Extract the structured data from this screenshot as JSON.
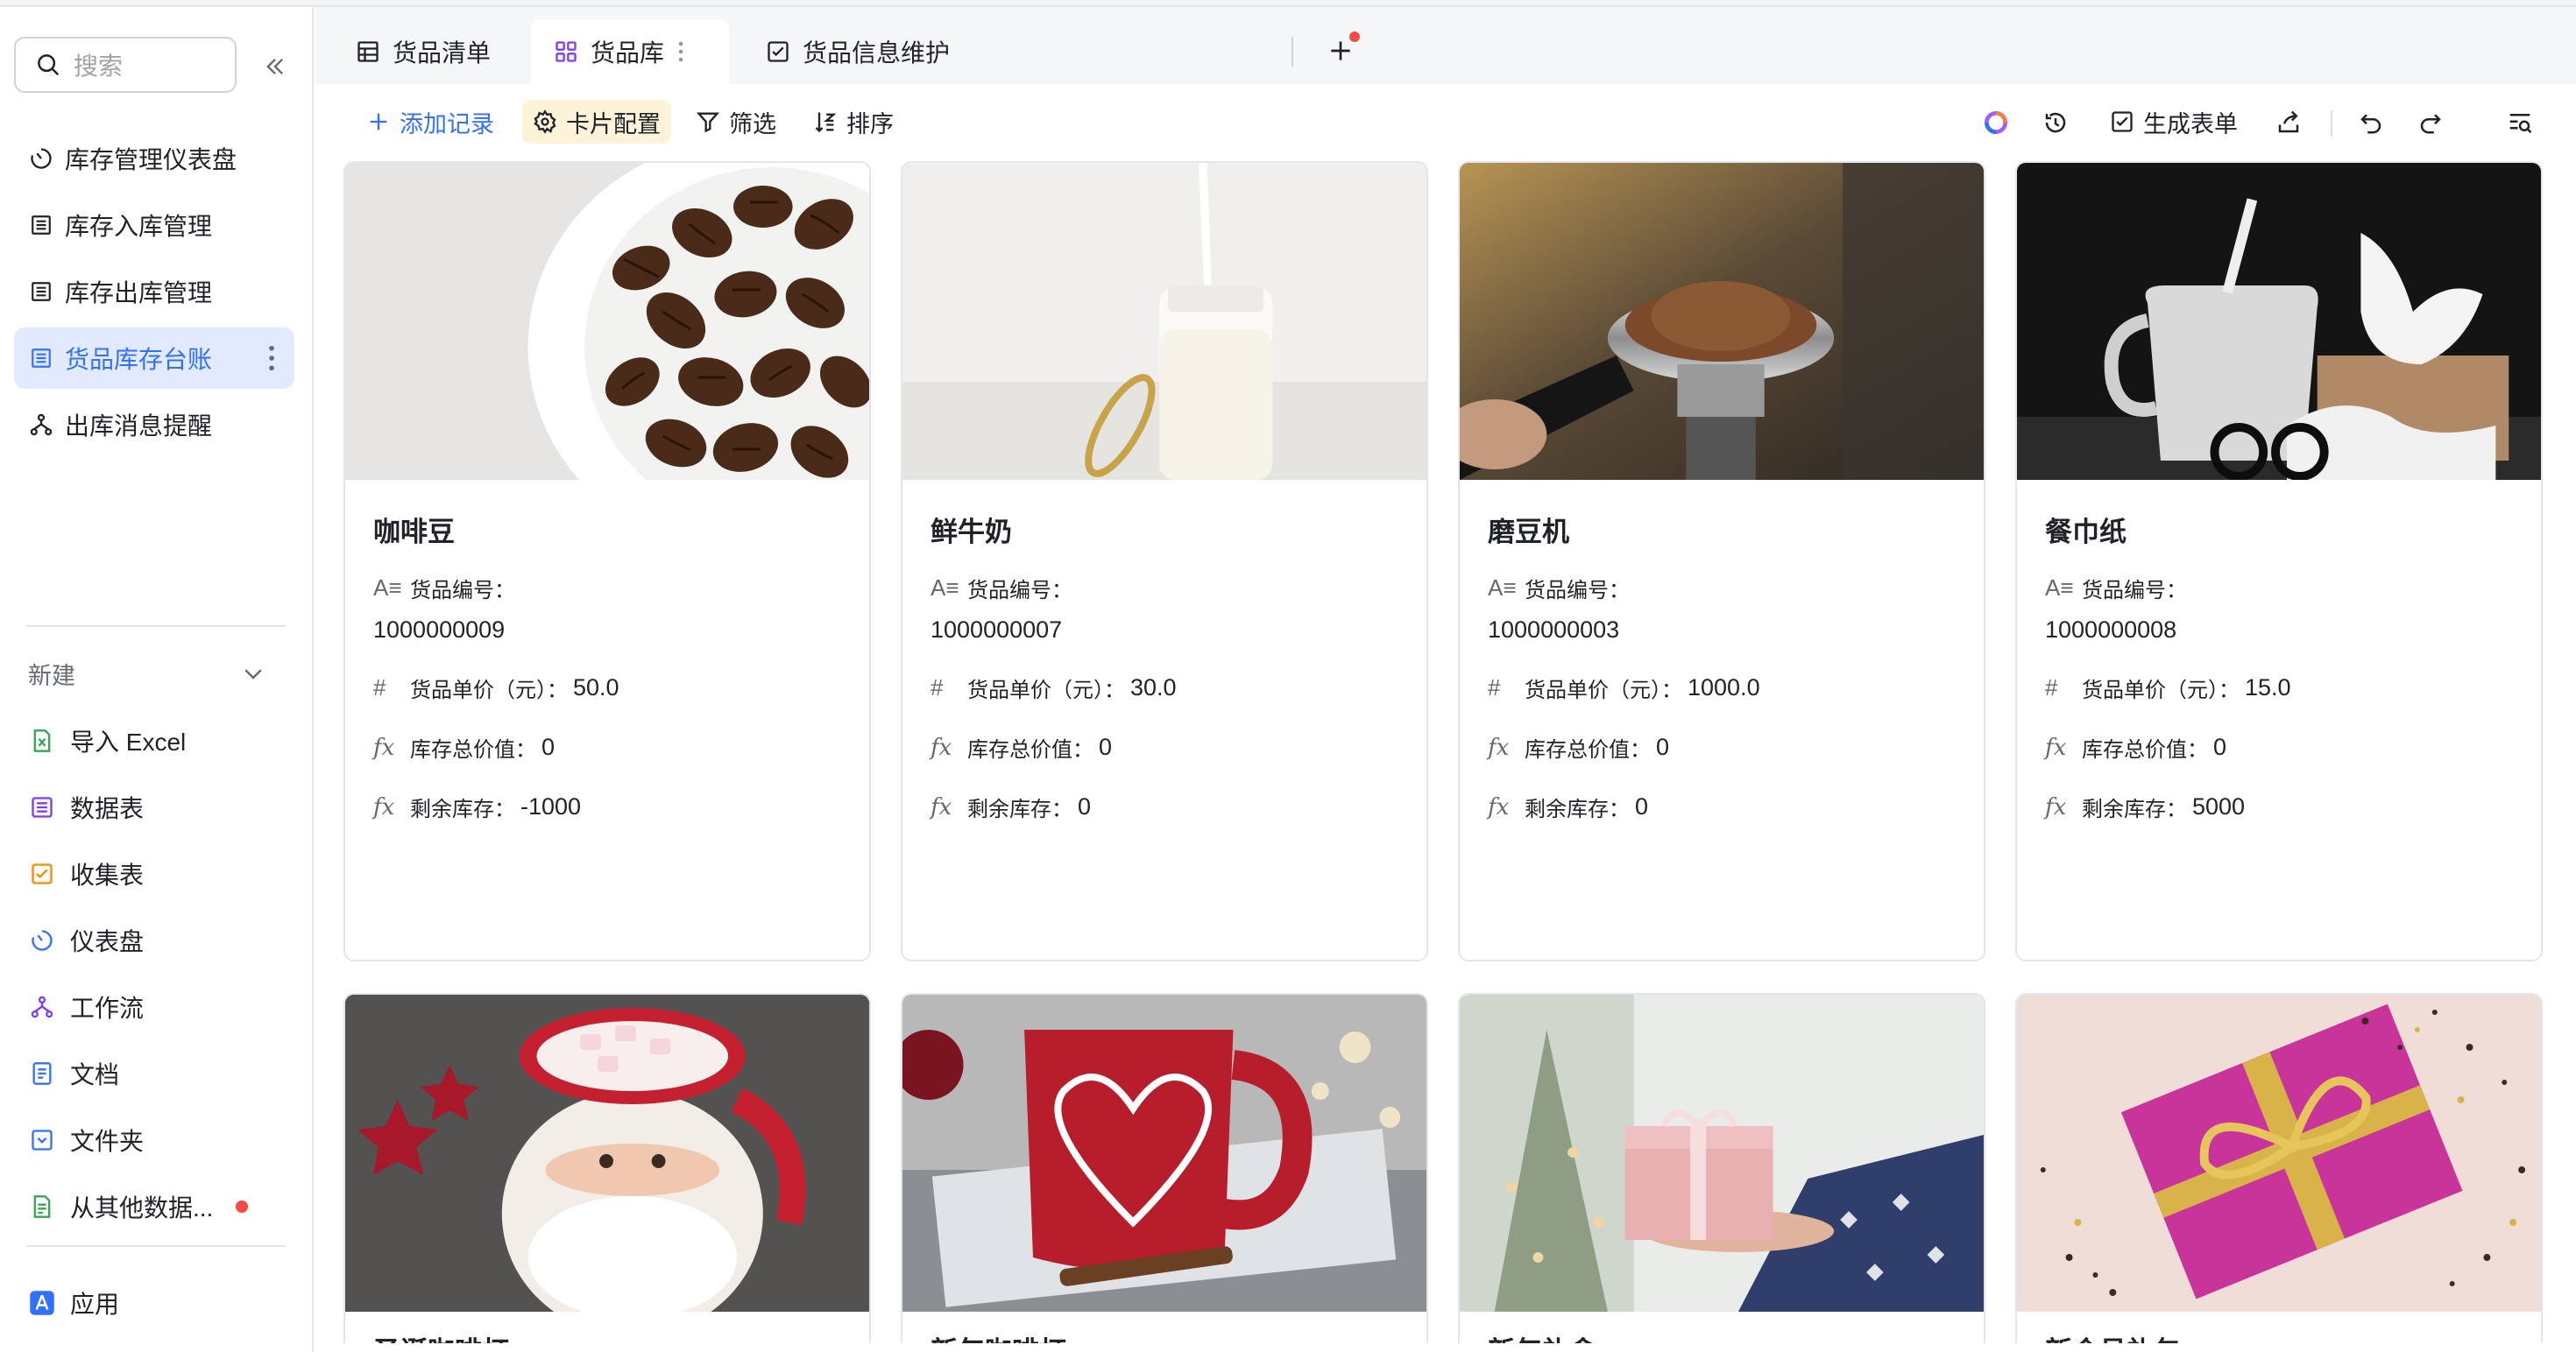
{
  "sidebar": {
    "search_placeholder": "搜索",
    "nav": [
      {
        "label": "库存管理仪表盘",
        "icon": "dashboard-icon"
      },
      {
        "label": "库存入库管理",
        "icon": "table-icon"
      },
      {
        "label": "库存出库管理",
        "icon": "table-icon"
      },
      {
        "label": "货品库存台账",
        "icon": "table-icon",
        "active": true
      },
      {
        "label": "出库消息提醒",
        "icon": "workflow-icon"
      }
    ],
    "new_label": "新建",
    "new_items": [
      {
        "label": "导入 Excel",
        "icon": "excel-icon",
        "color": "#34a853"
      },
      {
        "label": "数据表",
        "icon": "datatable-icon",
        "color": "#7f3bf5"
      },
      {
        "label": "收集表",
        "icon": "form-icon",
        "color": "#ff8800"
      },
      {
        "label": "仪表盘",
        "icon": "dashboard-icon",
        "color": "#3370ff"
      },
      {
        "label": "工作流",
        "icon": "workflow-icon",
        "color": "#7f3bf5"
      },
      {
        "label": "文档",
        "icon": "doc-icon",
        "color": "#3370ff"
      },
      {
        "label": "文件夹",
        "icon": "folder-icon",
        "color": "#3370ff"
      },
      {
        "label": "从其他数据...",
        "icon": "import-data-icon",
        "color": "#34a853"
      }
    ],
    "apps_label": "应用"
  },
  "tabs": [
    {
      "label": "货品清单",
      "icon": "grid-table-icon"
    },
    {
      "label": "货品库",
      "icon": "gallery-icon",
      "active": true
    },
    {
      "label": "货品信息维护",
      "icon": "form-check-icon"
    }
  ],
  "toolbar": {
    "add_record": "添加记录",
    "card_config": "卡片配置",
    "filter": "筛选",
    "sort": "排序",
    "generate_form": "生成表单"
  },
  "fields": {
    "code": "货品编号：",
    "price": "货品单价（元）：",
    "total_value": "库存总价值：",
    "remaining": "剩余库存："
  },
  "cards": [
    {
      "title": "咖啡豆",
      "code": "1000000009",
      "price": "50.0",
      "total_value": "0",
      "remaining": "-1000"
    },
    {
      "title": "鲜牛奶",
      "code": "1000000007",
      "price": "30.0",
      "total_value": "0",
      "remaining": "0"
    },
    {
      "title": "磨豆机",
      "code": "1000000003",
      "price": "1000.0",
      "total_value": "0",
      "remaining": "0"
    },
    {
      "title": "餐巾纸",
      "code": "1000000008",
      "price": "15.0",
      "total_value": "0",
      "remaining": "5000"
    }
  ],
  "cards_row2": [
    {
      "title": "圣诞咖啡杯"
    },
    {
      "title": "新年咖啡杯"
    },
    {
      "title": "新年礼盒"
    },
    {
      "title": "新会员礼包"
    }
  ]
}
